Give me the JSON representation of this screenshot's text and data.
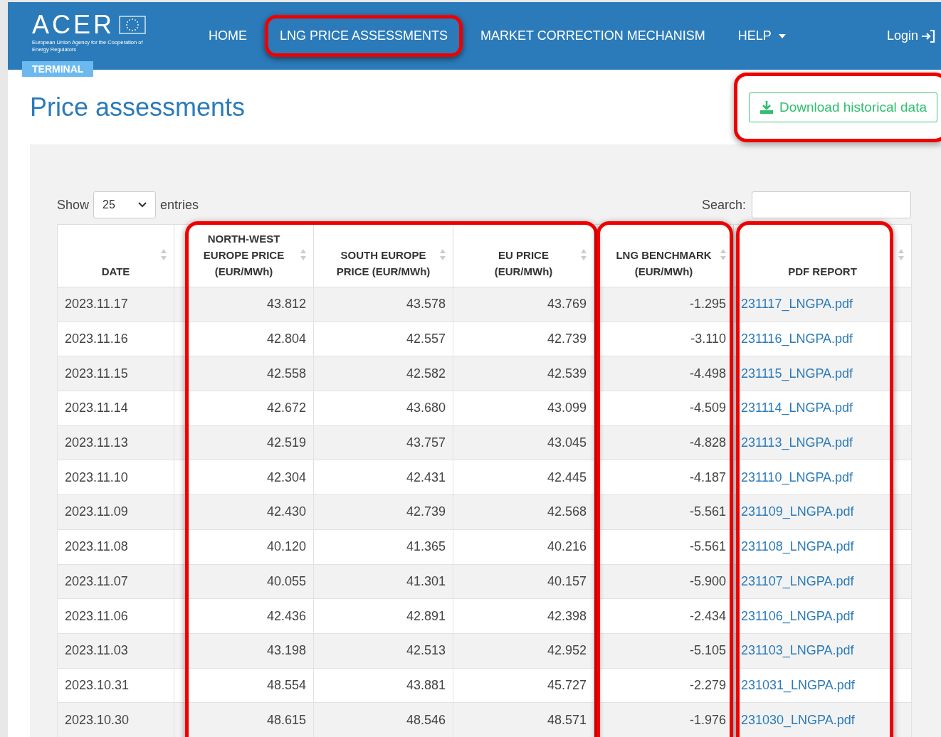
{
  "logo": {
    "name": "ACER",
    "tagline": "European Union Agency for the Cooperation of Energy Regulators",
    "badge": "TERMINAL"
  },
  "nav": [
    {
      "label": "HOME",
      "dropdown": false,
      "highlighted": false
    },
    {
      "label": "LNG PRICE ASSESSMENTS",
      "dropdown": false,
      "highlighted": true
    },
    {
      "label": "MARKET CORRECTION MECHANISM",
      "dropdown": false,
      "highlighted": false
    },
    {
      "label": "HELP",
      "dropdown": true,
      "highlighted": false
    }
  ],
  "login": "Login",
  "page_title": "Price assessments",
  "download_button": {
    "label": "Download historical data",
    "highlighted": true
  },
  "length_control": {
    "before": "Show",
    "value": "25",
    "after": "entries"
  },
  "search": {
    "label": "Search:"
  },
  "table": {
    "column_groups": [
      {
        "highlighted": false,
        "columns": [
          {
            "label": "DATE",
            "kind": "text"
          }
        ]
      },
      {
        "highlighted": true,
        "columns": [
          {
            "label": "NORTH-WEST EUROPE PRICE (EUR/MWh)",
            "kind": "number"
          },
          {
            "label": "SOUTH EUROPE PRICE (EUR/MWh)",
            "kind": "number"
          },
          {
            "label": "EU PRICE (EUR/MWh)",
            "kind": "number"
          }
        ]
      },
      {
        "highlighted": true,
        "columns": [
          {
            "label": "LNG BENCHMARK (EUR/MWh)",
            "kind": "number"
          }
        ]
      },
      {
        "highlighted": true,
        "columns": [
          {
            "label": "PDF REPORT",
            "kind": "link"
          }
        ]
      }
    ],
    "rows": [
      [
        "2023.11.17",
        "43.812",
        "43.578",
        "43.769",
        "-1.295",
        "231117_LNGPA.pdf"
      ],
      [
        "2023.11.16",
        "42.804",
        "42.557",
        "42.739",
        "-3.110",
        "231116_LNGPA.pdf"
      ],
      [
        "2023.11.15",
        "42.558",
        "42.582",
        "42.539",
        "-4.498",
        "231115_LNGPA.pdf"
      ],
      [
        "2023.11.14",
        "42.672",
        "43.680",
        "43.099",
        "-4.509",
        "231114_LNGPA.pdf"
      ],
      [
        "2023.11.13",
        "42.519",
        "43.757",
        "43.045",
        "-4.828",
        "231113_LNGPA.pdf"
      ],
      [
        "2023.11.10",
        "42.304",
        "42.431",
        "42.445",
        "-4.187",
        "231110_LNGPA.pdf"
      ],
      [
        "2023.11.09",
        "42.430",
        "42.739",
        "42.568",
        "-5.561",
        "231109_LNGPA.pdf"
      ],
      [
        "2023.11.08",
        "40.120",
        "41.365",
        "40.216",
        "-5.561",
        "231108_LNGPA.pdf"
      ],
      [
        "2023.11.07",
        "40.055",
        "41.301",
        "40.157",
        "-5.900",
        "231107_LNGPA.pdf"
      ],
      [
        "2023.11.06",
        "42.436",
        "42.891",
        "42.398",
        "-2.434",
        "231106_LNGPA.pdf"
      ],
      [
        "2023.11.03",
        "43.198",
        "42.513",
        "42.952",
        "-5.105",
        "231103_LNGPA.pdf"
      ],
      [
        "2023.10.31",
        "48.554",
        "43.881",
        "45.727",
        "-2.279",
        "231031_LNGPA.pdf"
      ],
      [
        "2023.10.30",
        "48.615",
        "48.546",
        "48.571",
        "-1.976",
        "231030_LNGPA.pdf"
      ]
    ]
  }
}
